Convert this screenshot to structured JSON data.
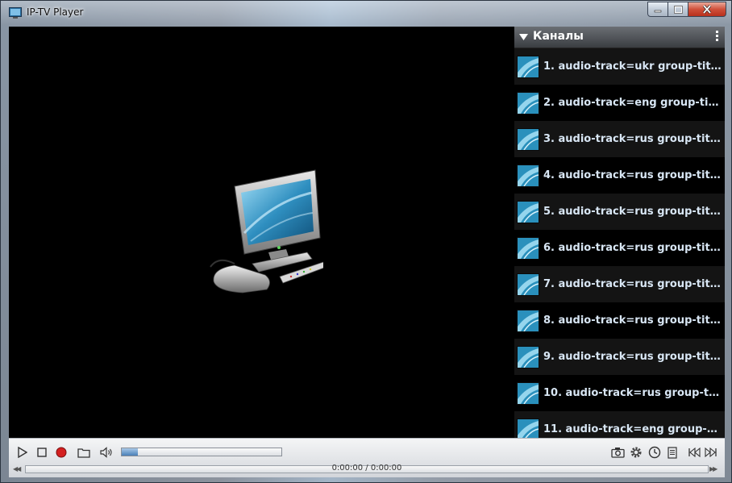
{
  "window": {
    "title": "IP-TV Player",
    "minimize_icon": "minimize-icon",
    "maximize_icon": "maximize-icon",
    "close_icon": "close-icon"
  },
  "video": {
    "placeholder_icon": "tv-set-with-remote-illustration"
  },
  "sidebar": {
    "title": "Каналы",
    "collapse_icon": "triangle-down-icon",
    "menu_icon": "vertical-dots-icon",
    "channels": [
      {
        "label": "1. audio-track=ukr group-title=..."
      },
      {
        "label": "2. audio-track=eng group-title=..."
      },
      {
        "label": "3. audio-track=rus group-title=..."
      },
      {
        "label": "4. audio-track=rus group-title=..."
      },
      {
        "label": "5. audio-track=rus group-title=..."
      },
      {
        "label": "6. audio-track=rus group-title=..."
      },
      {
        "label": "7. audio-track=rus group-title=..."
      },
      {
        "label": "8. audio-track=rus group-title=..."
      },
      {
        "label": "9. audio-track=rus group-title=..."
      },
      {
        "label": "10. audio-track=rus group-title..."
      },
      {
        "label": "11. audio-track=eng group-title..."
      }
    ]
  },
  "controls": {
    "time": "0:00:00 / 0:00:00",
    "volume_level": 0.1,
    "icons": [
      "play-icon",
      "stop-icon",
      "record-icon",
      "folder-icon",
      "speaker-icon",
      "camera-icon",
      "gear-icon",
      "clock-icon",
      "document-icon",
      "previous-icon",
      "next-icon"
    ],
    "accent": "#4a80b8",
    "record_color": "#d42020"
  }
}
